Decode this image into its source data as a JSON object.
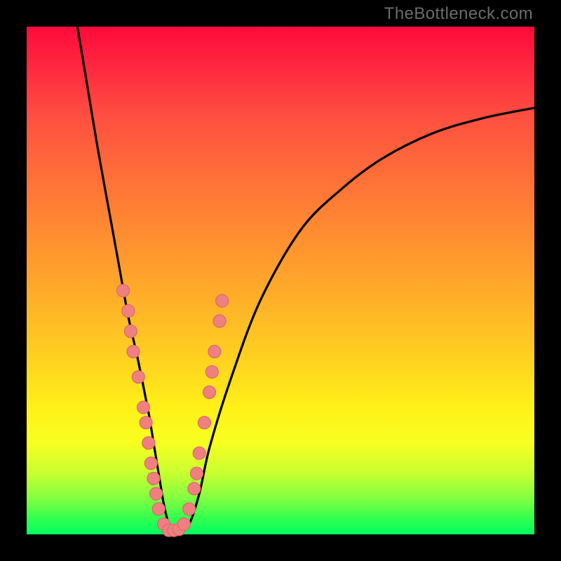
{
  "attribution": "TheBottleneck.com",
  "colors": {
    "frame": "#000000",
    "dot_fill": "#f08080",
    "dot_stroke": "#d86a6a",
    "curve_stroke": "#000000"
  },
  "chart_data": {
    "type": "line",
    "title": "",
    "xlabel": "",
    "ylabel": "",
    "xlim": [
      0,
      100
    ],
    "ylim": [
      0,
      100
    ],
    "grid": false,
    "legend": false,
    "series": [
      {
        "name": "bottleneck-curve",
        "x": [
          10,
          12,
          14,
          16,
          18,
          20,
          22,
          24,
          25,
          26,
          27,
          28,
          29,
          30,
          32,
          34,
          36,
          40,
          46,
          54,
          62,
          70,
          80,
          90,
          100
        ],
        "y": [
          100,
          88,
          76,
          65,
          54,
          43,
          34,
          24,
          18,
          12,
          6,
          2,
          0.5,
          0.5,
          2,
          8,
          17,
          30,
          46,
          60,
          68,
          74,
          79,
          82,
          84
        ]
      }
    ],
    "annotations": {
      "dots_note": "salmon scatter points clustered along lower V of the curve",
      "dots": [
        {
          "x": 19,
          "y": 48
        },
        {
          "x": 20,
          "y": 44
        },
        {
          "x": 20.5,
          "y": 40
        },
        {
          "x": 21,
          "y": 36
        },
        {
          "x": 22,
          "y": 31
        },
        {
          "x": 23,
          "y": 25
        },
        {
          "x": 23.5,
          "y": 22
        },
        {
          "x": 24,
          "y": 18
        },
        {
          "x": 24.5,
          "y": 14
        },
        {
          "x": 25,
          "y": 11
        },
        {
          "x": 25.5,
          "y": 8
        },
        {
          "x": 26,
          "y": 5
        },
        {
          "x": 27,
          "y": 2
        },
        {
          "x": 28,
          "y": 0.8
        },
        {
          "x": 29,
          "y": 0.8
        },
        {
          "x": 30,
          "y": 1
        },
        {
          "x": 31,
          "y": 2
        },
        {
          "x": 32,
          "y": 5
        },
        {
          "x": 33,
          "y": 9
        },
        {
          "x": 33.5,
          "y": 12
        },
        {
          "x": 34,
          "y": 16
        },
        {
          "x": 35,
          "y": 22
        },
        {
          "x": 36,
          "y": 28
        },
        {
          "x": 36.5,
          "y": 32
        },
        {
          "x": 37,
          "y": 36
        },
        {
          "x": 38,
          "y": 42
        },
        {
          "x": 38.5,
          "y": 46
        }
      ]
    }
  }
}
